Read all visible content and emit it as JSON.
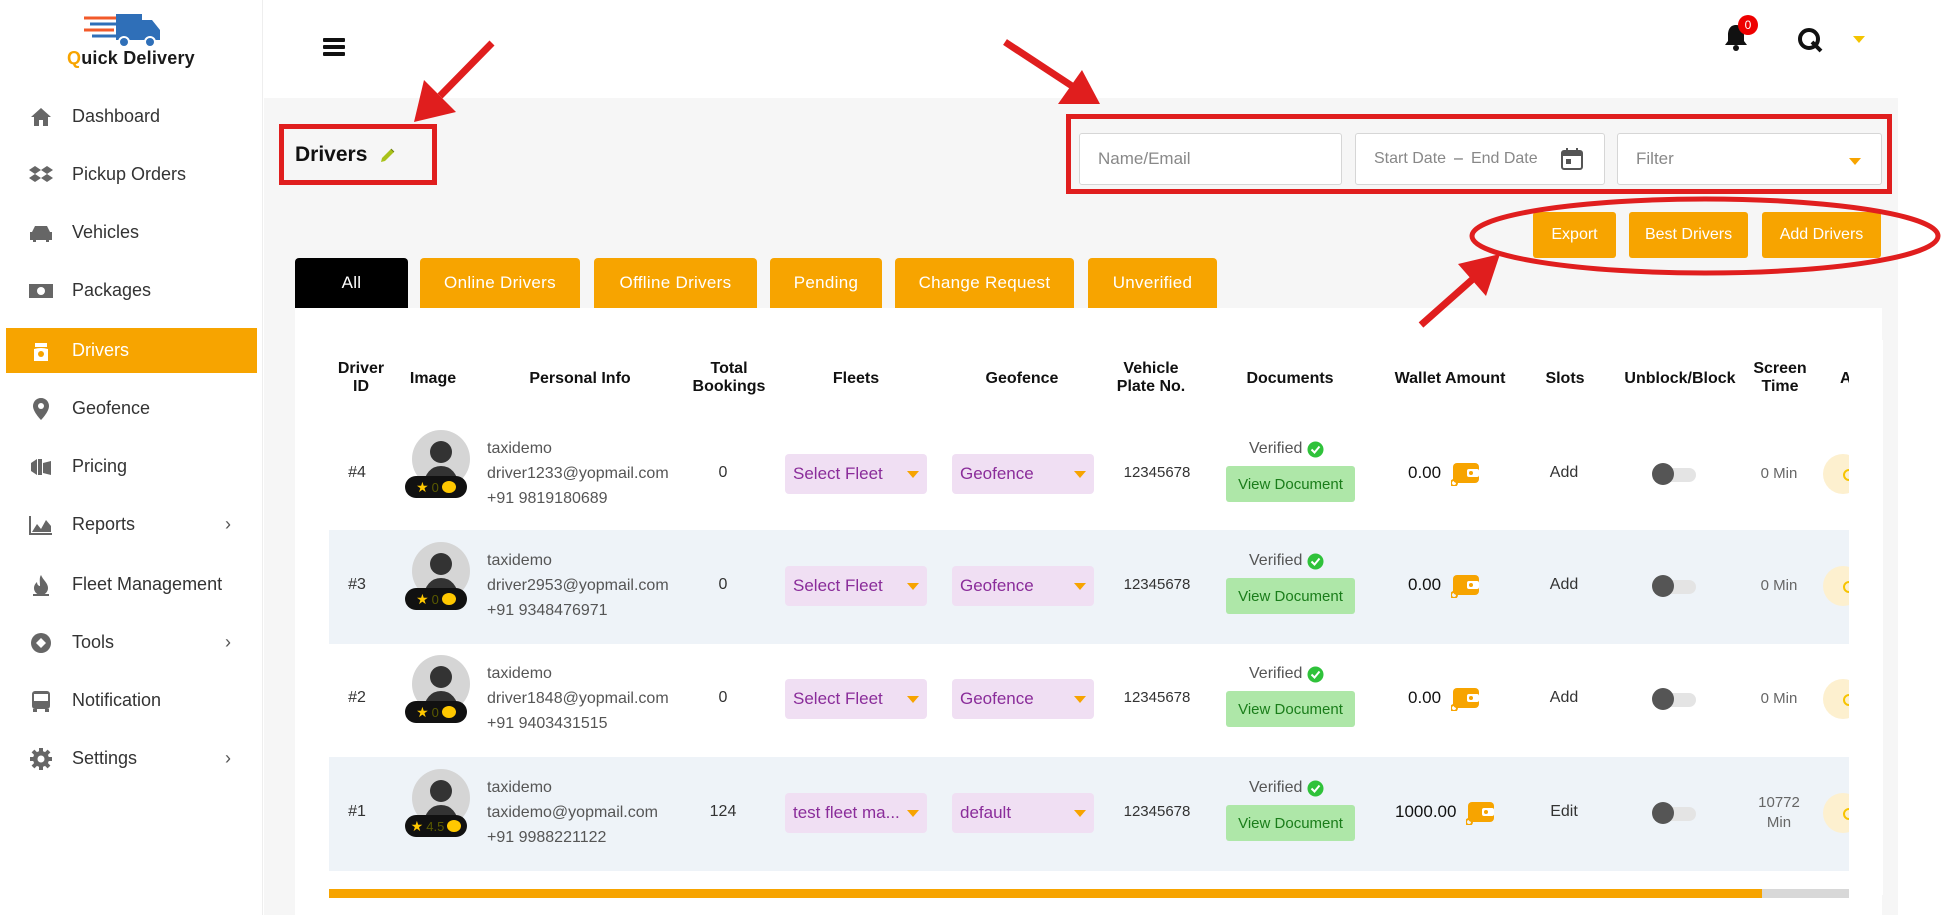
{
  "brand": {
    "logo_text_q": "Q",
    "logo_text_rest": "uick Delivery"
  },
  "sidebar": {
    "items": [
      {
        "label": "Dashboard",
        "icon": "home-icon",
        "chevron": false,
        "active": false
      },
      {
        "label": "Pickup Orders",
        "icon": "dropbox-icon",
        "chevron": false,
        "active": false
      },
      {
        "label": "Vehicles",
        "icon": "car-icon",
        "chevron": false,
        "active": false
      },
      {
        "label": "Packages",
        "icon": "money-icon",
        "chevron": false,
        "active": false
      },
      {
        "label": "Drivers",
        "icon": "driver-icon",
        "chevron": false,
        "active": true
      },
      {
        "label": "Geofence",
        "icon": "map-pin-icon",
        "chevron": false,
        "active": false
      },
      {
        "label": "Pricing",
        "icon": "pricing-icon",
        "chevron": false,
        "active": false
      },
      {
        "label": "Reports",
        "icon": "chart-area-icon",
        "chevron": true,
        "active": false
      },
      {
        "label": "Fleet Management",
        "icon": "flame-icon",
        "chevron": false,
        "active": false
      },
      {
        "label": "Tools",
        "icon": "tools-icon",
        "chevron": true,
        "active": false
      },
      {
        "label": "Notification",
        "icon": "bus-icon",
        "chevron": false,
        "active": false
      },
      {
        "label": "Settings",
        "icon": "gear-icon",
        "chevron": true,
        "active": false
      }
    ]
  },
  "header": {
    "notification_count": "0"
  },
  "page": {
    "title": "Drivers"
  },
  "filters": {
    "search_placeholder": "Name/Email",
    "start_date_placeholder": "Start Date",
    "date_separator": "–",
    "end_date_placeholder": "End Date",
    "filter_placeholder": "Filter"
  },
  "actions": {
    "export": "Export",
    "best_drivers": "Best Drivers",
    "add_drivers": "Add Drivers"
  },
  "tabs": [
    "All",
    "Online Drivers",
    "Offline Drivers",
    "Pending",
    "Change Request",
    "Unverified"
  ],
  "table": {
    "headers": {
      "driver_id": [
        "Driver",
        "ID"
      ],
      "image": "Image",
      "personal_info": "Personal Info",
      "total_bookings": [
        "Total",
        "Bookings"
      ],
      "fleets": "Fleets",
      "geofence": "Geofence",
      "vehicle_plate": [
        "Vehicle",
        "Plate No."
      ],
      "documents": "Documents",
      "wallet_amount": "Wallet Amount",
      "slots": "Slots",
      "unblock_block": "Unblock/Block",
      "screen_time": [
        "Screen",
        "Time"
      ],
      "action_partial": "A"
    },
    "rows": [
      {
        "id": "#4",
        "rating": "0",
        "name": "taxidemo",
        "email": "driver1233@yopmail.com",
        "phone": "+91 9819180689",
        "bookings": "0",
        "fleet": "Select Fleet",
        "geofence": "Geofence",
        "plate": "12345678",
        "doc_status": "Verified",
        "view_doc": "View Document",
        "wallet": "0.00",
        "slots": "Add",
        "screen_time": [
          "0 Min"
        ]
      },
      {
        "id": "#3",
        "rating": "0",
        "name": "taxidemo",
        "email": "driver2953@yopmail.com",
        "phone": "+91 9348476971",
        "bookings": "0",
        "fleet": "Select Fleet",
        "geofence": "Geofence",
        "plate": "12345678",
        "doc_status": "Verified",
        "view_doc": "View Document",
        "wallet": "0.00",
        "slots": "Add",
        "screen_time": [
          "0 Min"
        ]
      },
      {
        "id": "#2",
        "rating": "0",
        "name": "taxidemo",
        "email": "driver1848@yopmail.com",
        "phone": "+91 9403431515",
        "bookings": "0",
        "fleet": "Select Fleet",
        "geofence": "Geofence",
        "plate": "12345678",
        "doc_status": "Verified",
        "view_doc": "View Document",
        "wallet": "0.00",
        "slots": "Add",
        "screen_time": [
          "0 Min"
        ]
      },
      {
        "id": "#1",
        "rating": "4.5",
        "name": "taxidemo",
        "email": "taxidemo@yopmail.com",
        "phone": "+91 9988221122",
        "bookings": "124",
        "fleet": "test fleet ma...",
        "geofence": "default",
        "plate": "12345678",
        "doc_status": "Verified",
        "view_doc": "View Document",
        "wallet": "1000.00",
        "slots": "Edit",
        "screen_time": [
          "10772",
          "Min"
        ]
      }
    ]
  },
  "colors": {
    "accent": "#f7a400",
    "annotation": "#e01e1e",
    "verified_bg": "#aee7a8",
    "select_bg": "#f0dff3"
  }
}
